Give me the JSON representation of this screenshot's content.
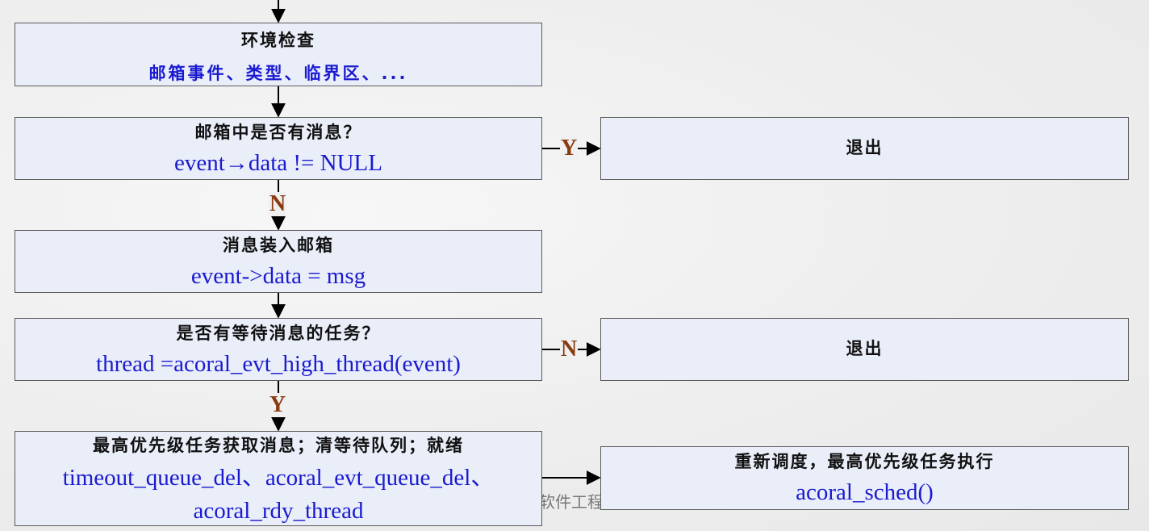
{
  "box1": {
    "title": "环境检查",
    "detail": "邮箱事件、类型、临界区、..."
  },
  "box2": {
    "title": "邮箱中是否有消息？",
    "detail": "event→data != NULL"
  },
  "box3": {
    "title": "消息装入邮箱",
    "detail": "event->data = msg"
  },
  "box4": {
    "title": "是否有等待消息的任务？",
    "detail": "thread =acoral_evt_high_thread(event)"
  },
  "box5": {
    "title": "最高优先级任务获取消息；清等待队列；就绪",
    "detail_line1": "timeout_queue_del、acoral_evt_queue_del、",
    "detail_line2": "acoral_rdy_thread"
  },
  "exit1": {
    "label": "退出"
  },
  "exit2": {
    "label": "退出"
  },
  "box6": {
    "title": "重新调度，最高优先级任务执行",
    "detail": "acoral_sched()"
  },
  "labels": {
    "y1": "Y",
    "n1": "N",
    "n2": "N",
    "y2": "Y"
  },
  "footer": {
    "text": "软件工程专候"
  }
}
